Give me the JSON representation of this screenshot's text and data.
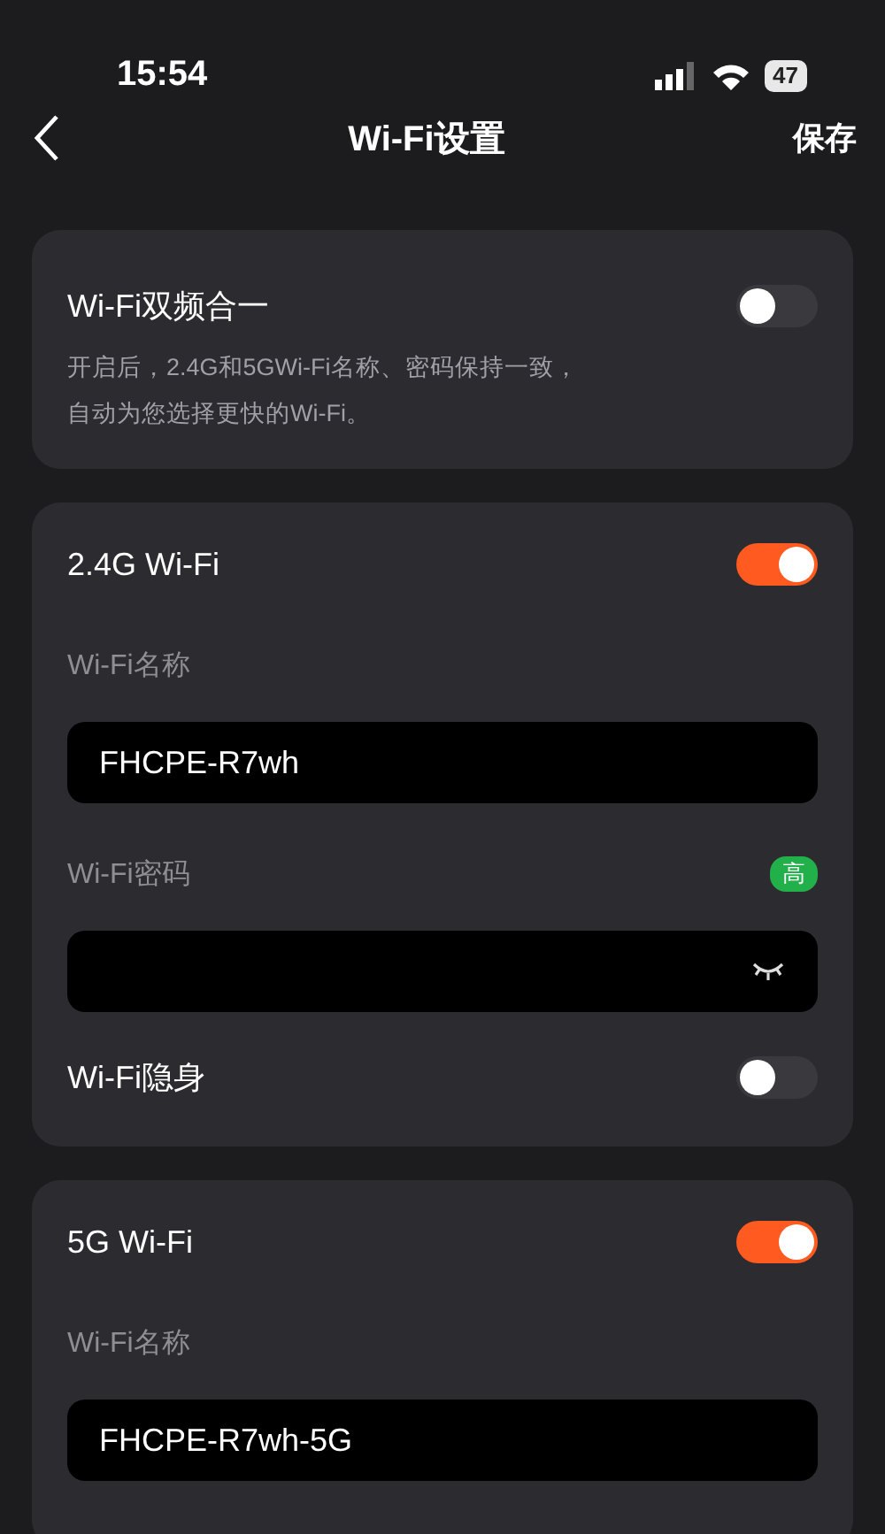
{
  "status_bar": {
    "time": "15:54",
    "battery": "47"
  },
  "nav": {
    "title": "Wi-Fi设置",
    "action": "保存"
  },
  "sections": [
    {
      "kind": "merge",
      "title": "Wi-Fi双频合一",
      "on": false,
      "description": [
        "开启后，2.4G和5GWi-Fi名称、密码保持一致，",
        "自动为您选择更快的Wi-Fi。"
      ]
    },
    {
      "kind": "band",
      "title": "2.4G Wi-Fi",
      "on": true,
      "fields": [
        {
          "kind": "name",
          "label": "Wi-Fi名称",
          "value": "FHCPE-R7wh"
        },
        {
          "kind": "password",
          "label": "Wi-Fi密码",
          "strength": "高"
        }
      ],
      "hidden": {
        "label": "Wi-Fi隐身",
        "on": false
      }
    },
    {
      "kind": "band",
      "title": "5G Wi-Fi",
      "on": true,
      "fields": [
        {
          "kind": "name",
          "label": "Wi-Fi名称",
          "value": "FHCPE-R7wh-5G"
        }
      ]
    }
  ]
}
